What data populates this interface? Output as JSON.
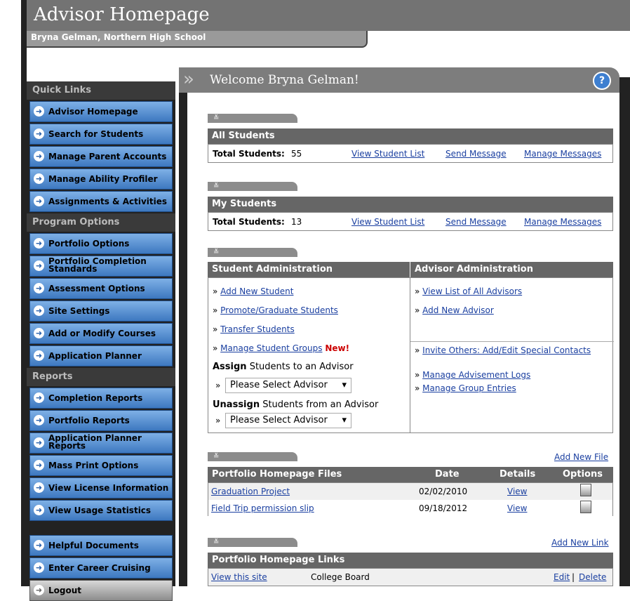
{
  "header": {
    "title": "Advisor Homepage",
    "subtitle": "Bryna Gelman, Northern High School"
  },
  "welcome": {
    "text": "Welcome Bryna Gelman!",
    "help": "?"
  },
  "sidebar": {
    "sections": [
      {
        "title": "Quick Links",
        "items": [
          "Advisor Homepage",
          "Search for Students",
          "Manage Parent Accounts",
          "Manage Ability Profiler",
          "Assignments & Activities"
        ]
      },
      {
        "title": "Program Options",
        "items": [
          "Portfolio Options",
          "Portfolio Completion Standards",
          "Assessment Options",
          "Site Settings",
          "Add or Modify Courses",
          "Application Planner"
        ]
      },
      {
        "title": "Reports",
        "items": [
          "Completion Reports",
          "Portfolio Reports",
          "Application Planner Reports",
          "Mass Print Options",
          "View License Information",
          "View Usage Statistics"
        ]
      }
    ],
    "extra": [
      "Helpful Documents",
      "Enter Career Cruising",
      "Logout"
    ]
  },
  "all_students": {
    "title": "All Students",
    "total_label": "Total Students:",
    "total": "55",
    "links": [
      "View Student List",
      "Send Message",
      "Manage Messages"
    ]
  },
  "my_students": {
    "title": "My Students",
    "total_label": "Total Students:",
    "total": "13",
    "links": [
      "View Student List",
      "Send Message",
      "Manage Messages"
    ]
  },
  "admin": {
    "student_title": "Student Administration",
    "advisor_title": "Advisor Administration",
    "student_links": [
      "Add New Student",
      "Promote/Graduate Students",
      "Transfer Students",
      "Manage Student Groups"
    ],
    "new_badge": "New!",
    "assign_bold": "Assign",
    "assign_rest": " Students to an Advisor",
    "unassign_bold": "Unassign",
    "unassign_rest": " Students from an Advisor",
    "select_placeholder": "Please Select Advisor",
    "advisor_links": [
      "View List of All Advisors",
      "Add New Advisor"
    ],
    "other_links": [
      "Invite Others: Add/Edit Special Contacts",
      "Manage Advisement Logs",
      "Manage Group Entries"
    ]
  },
  "files": {
    "add_link": "Add New File",
    "headers": [
      "Portfolio Homepage Files",
      "Date",
      "Details",
      "Options"
    ],
    "rows": [
      {
        "name": "Graduation Project",
        "date": "02/02/2010",
        "details": "View"
      },
      {
        "name": "Field Trip permission slip",
        "date": "09/18/2012",
        "details": "View"
      }
    ]
  },
  "links_panel": {
    "add_link": "Add New Link",
    "title": "Portfolio Homepage Links",
    "rows": [
      {
        "link": "View this site",
        "label": "College Board",
        "edit": "Edit",
        "sep": "|",
        "delete": "Delete"
      }
    ]
  },
  "glyphs": {
    "arrow": "➜",
    "chev": "»",
    "caret": "▾",
    "bullet": "»",
    "tab_chev": "≚"
  }
}
